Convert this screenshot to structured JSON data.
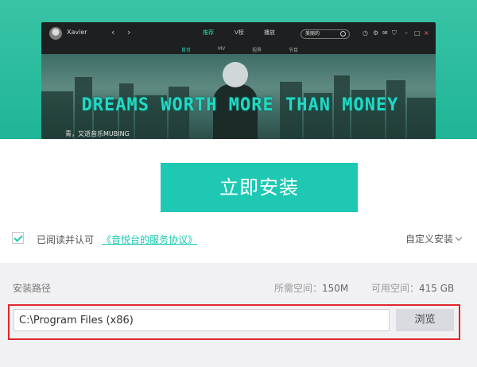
{
  "app_preview": {
    "user_name": "Xavier",
    "nav_tabs": [
      "推荐",
      "V榜",
      "播放"
    ],
    "active_tab": "推荐",
    "search_placeholder": "美丽的",
    "sub_nav": [
      "首页",
      "MV",
      "视界",
      "节目"
    ],
    "active_sub_nav": "首页",
    "banner_slogan": "DREAMS WORTH MORE THAN MONEY",
    "banner_caption": "青，又逝音乐MUBING"
  },
  "install": {
    "button_label": "立即安装"
  },
  "agreement": {
    "checked": true,
    "text": "已阅读并认可",
    "link_text": "《音悦台的服务协议》"
  },
  "custom_install_label": "自定义安装",
  "path_panel": {
    "label": "安装路径",
    "required_space_label": "所需空间：",
    "required_space_value": "150M",
    "free_space_label": "可用空间：",
    "free_space_value": "415 GB",
    "path_value": "C:\\Program Files (x86)",
    "browse_label": "浏览"
  },
  "colors": {
    "accent": "#1ec8b3",
    "highlight": "#e0262c"
  }
}
